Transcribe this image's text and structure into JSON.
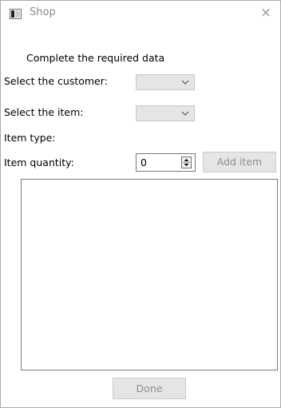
{
  "window": {
    "title": "Shop",
    "close_glyph": "×"
  },
  "form": {
    "heading": "Complete the required data",
    "customer_label": "Select the customer:",
    "customer_value": "",
    "item_label": "Select the item:",
    "item_value": "",
    "item_type_label": "Item type:",
    "item_type_value": "",
    "quantity_label": "Item quantity:",
    "quantity_value": "0",
    "add_item_label": "Add item"
  },
  "items_list": [],
  "footer": {
    "done_label": "Done"
  },
  "icons": {
    "app": "app-window-icon",
    "close": "close-icon",
    "combo": "chevron-down-icon",
    "spin": "spinner-arrows-icon"
  },
  "colors": {
    "disabled_text": "#8f8f8f",
    "disabled_bg": "#e5e5e5",
    "title_text": "#8a8a8a"
  }
}
